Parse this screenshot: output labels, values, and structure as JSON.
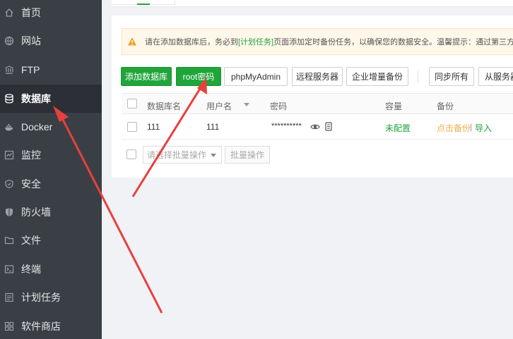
{
  "sidebar": {
    "items": [
      {
        "label": "首页",
        "icon": "home-icon"
      },
      {
        "label": "网站",
        "icon": "globe-icon"
      },
      {
        "label": "FTP",
        "icon": "ftp-icon"
      },
      {
        "label": "数据库",
        "icon": "database-icon",
        "active": true
      },
      {
        "label": "Docker",
        "icon": "docker-icon"
      },
      {
        "label": "监控",
        "icon": "monitor-icon"
      },
      {
        "label": "安全",
        "icon": "shield-icon"
      },
      {
        "label": "防火墙",
        "icon": "firewall-icon"
      },
      {
        "label": "文件",
        "icon": "folder-icon"
      },
      {
        "label": "终端",
        "icon": "terminal-icon"
      },
      {
        "label": "计划任务",
        "icon": "calendar-icon"
      },
      {
        "label": "软件商店",
        "icon": "grid-icon"
      }
    ]
  },
  "notice": {
    "prefix": "请在添加数据库后，务必到",
    "link": "[计划任务]",
    "suffix": "页面添加定时备份任务，以确保您的数据安全。温馨提示：通过第三方"
  },
  "toolbar": {
    "add_db": "添加数据库",
    "root_pwd": "root密码",
    "phpmyadmin": "phpMyAdmin",
    "remote_server": "远程服务器",
    "enterprise_backup": "企业增量备份",
    "sync_all": "同步所有",
    "from_server": "从服务器"
  },
  "table": {
    "headers": {
      "db_name": "数据库名",
      "username": "用户名",
      "password": "密码",
      "capacity": "容量",
      "backup": "备份"
    },
    "rows": [
      {
        "db_name": "111",
        "username": "111",
        "password": "**********",
        "capacity": "未配置",
        "backup_link": "点击备份",
        "separator": "|",
        "import_link": "导入"
      }
    ]
  },
  "batch": {
    "select_placeholder": "请选择批量操作",
    "button": "批量操作"
  },
  "colors": {
    "accent": "#20a53a",
    "sidebar_bg": "#3a3f45",
    "arrow": "#e8403d",
    "warning": "#f0ad4e"
  }
}
